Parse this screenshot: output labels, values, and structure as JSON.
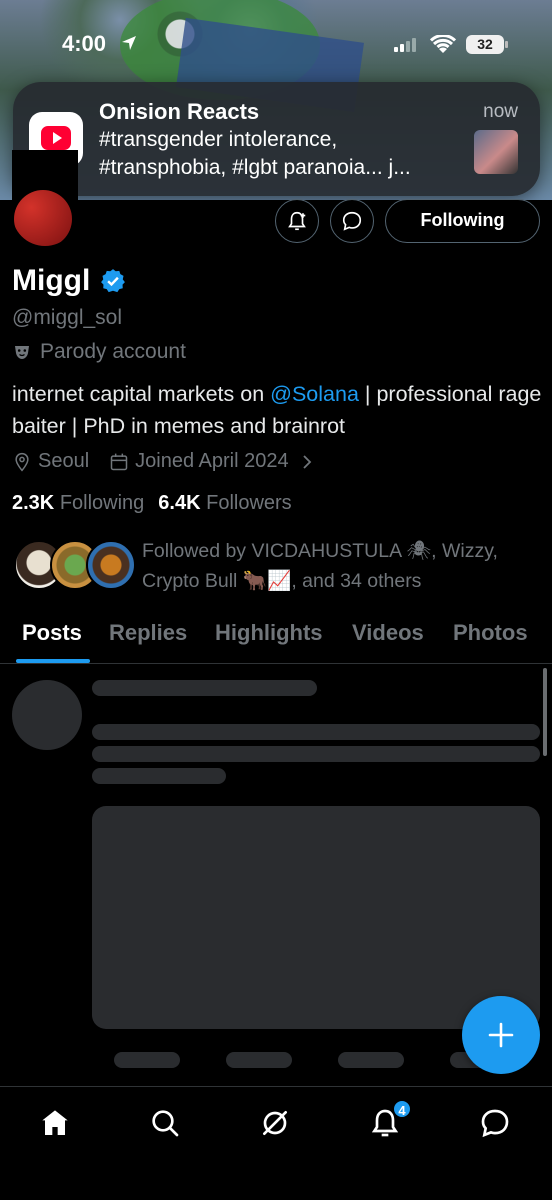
{
  "status_bar": {
    "time": "4:00",
    "battery": "32"
  },
  "notification": {
    "app_icon": "youtube-icon",
    "title": "Onision Reacts",
    "time": "now",
    "body": "#transgender intolerance, #transphobia, #lgbt paranoia... j..."
  },
  "profile": {
    "name": "Miggl",
    "handle": "@miggl_sol",
    "parody_label": "Parody account",
    "bio_prefix": "internet capital markets on ",
    "bio_mention": "@Solana",
    "bio_suffix": " | professional rage baiter | PhD in memes and brainrot",
    "location": "Seoul",
    "joined": "Joined April 2024",
    "following_count": "2.3K",
    "following_label": "Following",
    "followers_count": "6.4K",
    "followers_label": "Followers",
    "followed_by": "Followed by VICDAHUSTULA 🕷, Wizzy, Crypto Bull 🐂📈, and 34 others",
    "follow_button": "Following"
  },
  "tabs": [
    {
      "label": "Posts",
      "active": true
    },
    {
      "label": "Replies",
      "active": false
    },
    {
      "label": "Highlights",
      "active": false
    },
    {
      "label": "Videos",
      "active": false
    },
    {
      "label": "Photos",
      "active": false
    }
  ],
  "bottom_nav": {
    "items": [
      "home-icon",
      "search-icon",
      "grok-icon",
      "notifications-icon",
      "messages-icon"
    ],
    "notification_badge": "4"
  },
  "colors": {
    "accent": "#1d9bf0",
    "background": "#000000",
    "muted": "#71767b"
  }
}
